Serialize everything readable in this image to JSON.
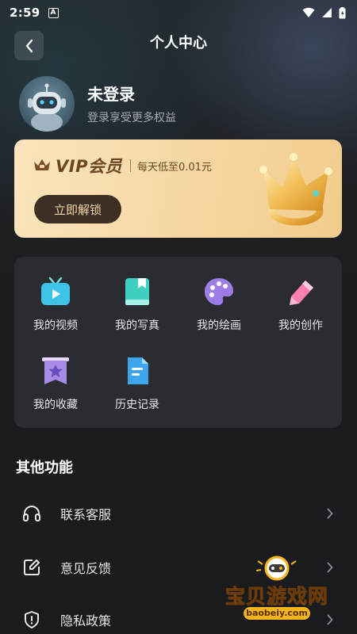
{
  "status_bar": {
    "time": "2:59",
    "notification_badge": "A"
  },
  "header": {
    "title": "个人中心"
  },
  "profile": {
    "name": "未登录",
    "subtitle": "登录享受更多权益"
  },
  "vip": {
    "title": "VIP会员",
    "promo": "每天低至0.01元",
    "button_label": "立即解锁"
  },
  "features": [
    {
      "label": "我的视频",
      "icon": "tv-icon"
    },
    {
      "label": "我的写真",
      "icon": "bookmark-book-icon"
    },
    {
      "label": "我的绘画",
      "icon": "palette-icon"
    },
    {
      "label": "我的创作",
      "icon": "eraser-icon"
    },
    {
      "label": "我的收藏",
      "icon": "star-banner-icon"
    },
    {
      "label": "历史记录",
      "icon": "document-icon"
    }
  ],
  "other": {
    "title": "其他功能",
    "items": [
      {
        "label": "联系客服",
        "icon": "headset-icon"
      },
      {
        "label": "意见反馈",
        "icon": "edit-feedback-icon"
      },
      {
        "label": "隐私政策",
        "icon": "shield-icon"
      }
    ]
  },
  "watermark": {
    "text": "宝贝游戏网",
    "url": "baobeiy.com"
  },
  "colors": {
    "background": "#1b1c20",
    "vip_gold": "#f7d9a6",
    "vip_text": "#6c4722",
    "panel": "#2a2c31"
  }
}
